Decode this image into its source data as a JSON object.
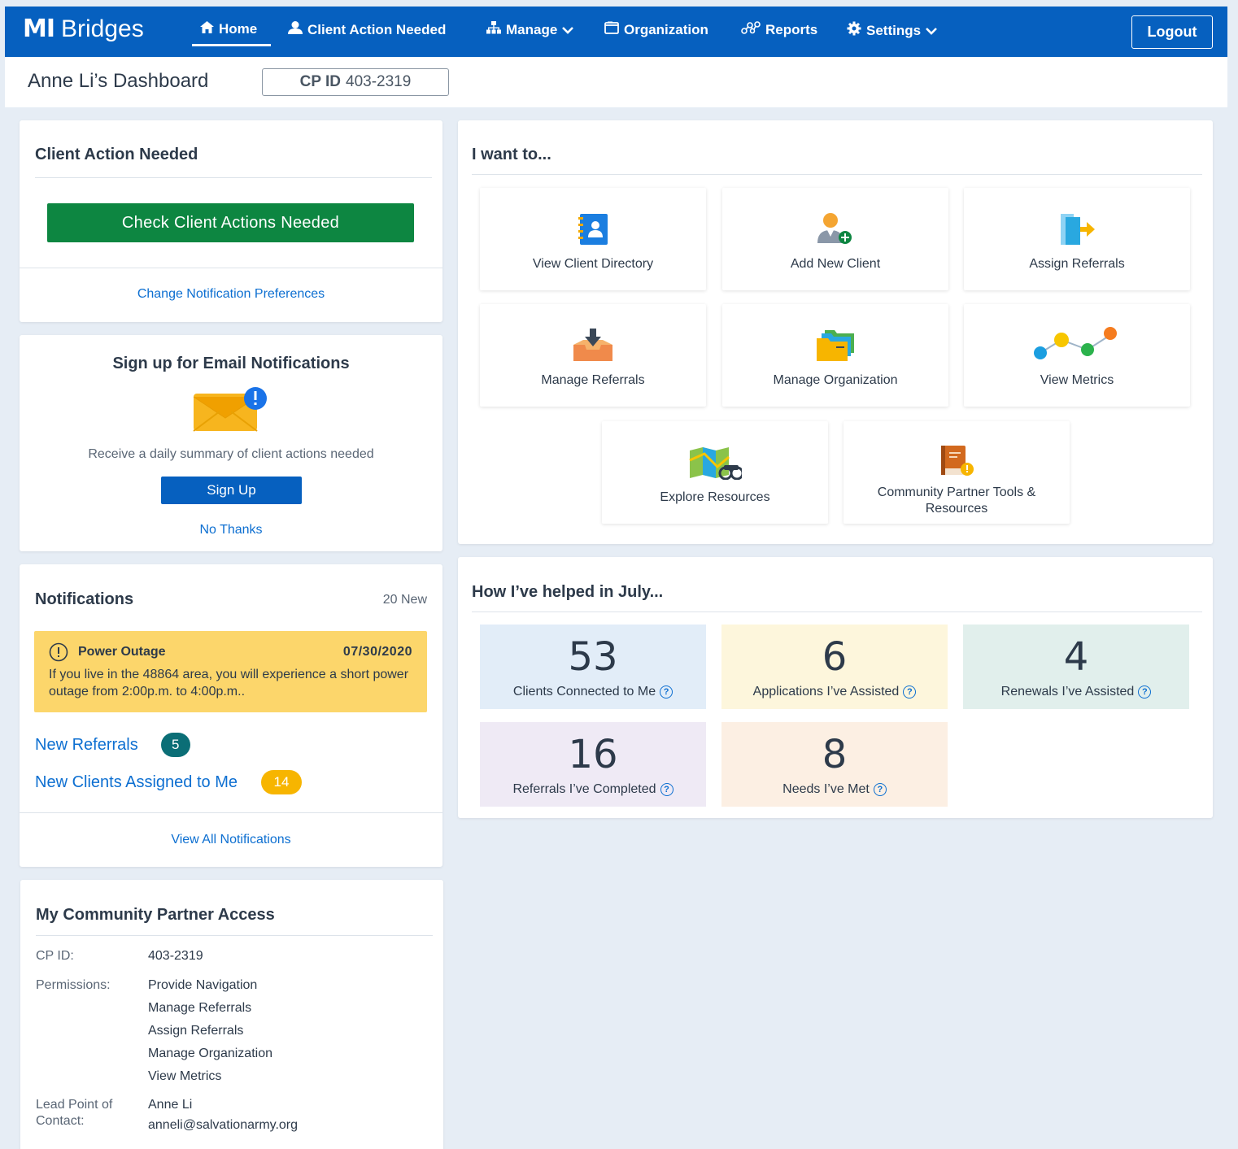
{
  "nav": {
    "logo_mark": "MI",
    "logo_text": "Bridges",
    "items": [
      {
        "label": "Home",
        "icon": "home-icon"
      },
      {
        "label": "Client Action Needed",
        "icon": "user-icon"
      },
      {
        "label": "Manage",
        "icon": "sitemap-icon"
      },
      {
        "label": "Organization",
        "icon": "folder-icon"
      },
      {
        "label": "Reports",
        "icon": "reports-icon"
      },
      {
        "label": "Settings",
        "icon": "gear-icon"
      }
    ],
    "logout_label": "Logout",
    "color": "#0660bf"
  },
  "header": {
    "title": "Anne Li’s Dashboard",
    "cp_label": "CP ID",
    "cp_value": "403-2319"
  },
  "client_action": {
    "title": "Client Action Needed",
    "button_label": "Check Client Actions Needed",
    "prefs_link": "Change Notification Preferences"
  },
  "email_signup": {
    "title": "Sign up for Email Notifications",
    "description": "Receive a daily summary of client actions needed",
    "signup_label": "Sign Up",
    "decline_label": "No Thanks"
  },
  "notifications": {
    "title": "Notifications",
    "count_label": "20 New",
    "alert": {
      "title": "Power Outage",
      "date": "07/30/2020",
      "body": "If you live in the 48864 area, you will experience a short power outage from 2:00p.m. to 4:00p.m.."
    },
    "items": [
      {
        "label": "New Referrals",
        "count": "5",
        "color": "#0b6e76"
      },
      {
        "label": "New Clients Assigned to Me",
        "count": "14",
        "color": "#f4b400"
      }
    ],
    "view_all": "View All Notifications"
  },
  "access": {
    "title": "My Community Partner Access",
    "cp_id_label": "CP ID:",
    "cp_id_value": "403-2319",
    "permissions_label": "Permissions:",
    "permissions": [
      "Provide Navigation",
      "Manage Referrals",
      "Assign Referrals",
      "Manage Organization",
      "View Metrics"
    ],
    "contact_label_1": "Lead Point of",
    "contact_label_2": "Contact:",
    "contact_name": "Anne Li",
    "contact_email": "anneli@salvationarmy.org"
  },
  "i_want_to": {
    "title": "I want to...",
    "tiles": [
      {
        "label": "View Client Directory",
        "icon": "address-book-icon"
      },
      {
        "label": "Add New Client",
        "icon": "add-user-icon"
      },
      {
        "label": "Assign Referrals",
        "icon": "assign-referral-icon"
      },
      {
        "label": "Manage Referrals",
        "icon": "inbox-download-icon"
      },
      {
        "label": "Manage Organization",
        "icon": "folders-icon"
      },
      {
        "label": "View Metrics",
        "icon": "metrics-icon"
      },
      {
        "label": "Explore Resources",
        "icon": "map-binoculars-icon"
      },
      {
        "label": "Community Partner Tools & Resources",
        "icon": "book-icon"
      }
    ]
  },
  "metrics": {
    "title": "How I’ve helped in July...",
    "stats": [
      {
        "value": "53",
        "label": "Clients Connected to Me",
        "color": "#e2edf8"
      },
      {
        "value": "6",
        "label": "Applications I’ve Assisted",
        "color": "#fdf6dc"
      },
      {
        "value": "4",
        "label": "Renewals I’ve Assisted",
        "color": "#e1efec"
      },
      {
        "value": "16",
        "label": "Referrals I’ve Completed",
        "color": "#efeaf5"
      },
      {
        "value": "8",
        "label": "Needs I’ve Met",
        "color": "#fcefe3"
      }
    ]
  }
}
